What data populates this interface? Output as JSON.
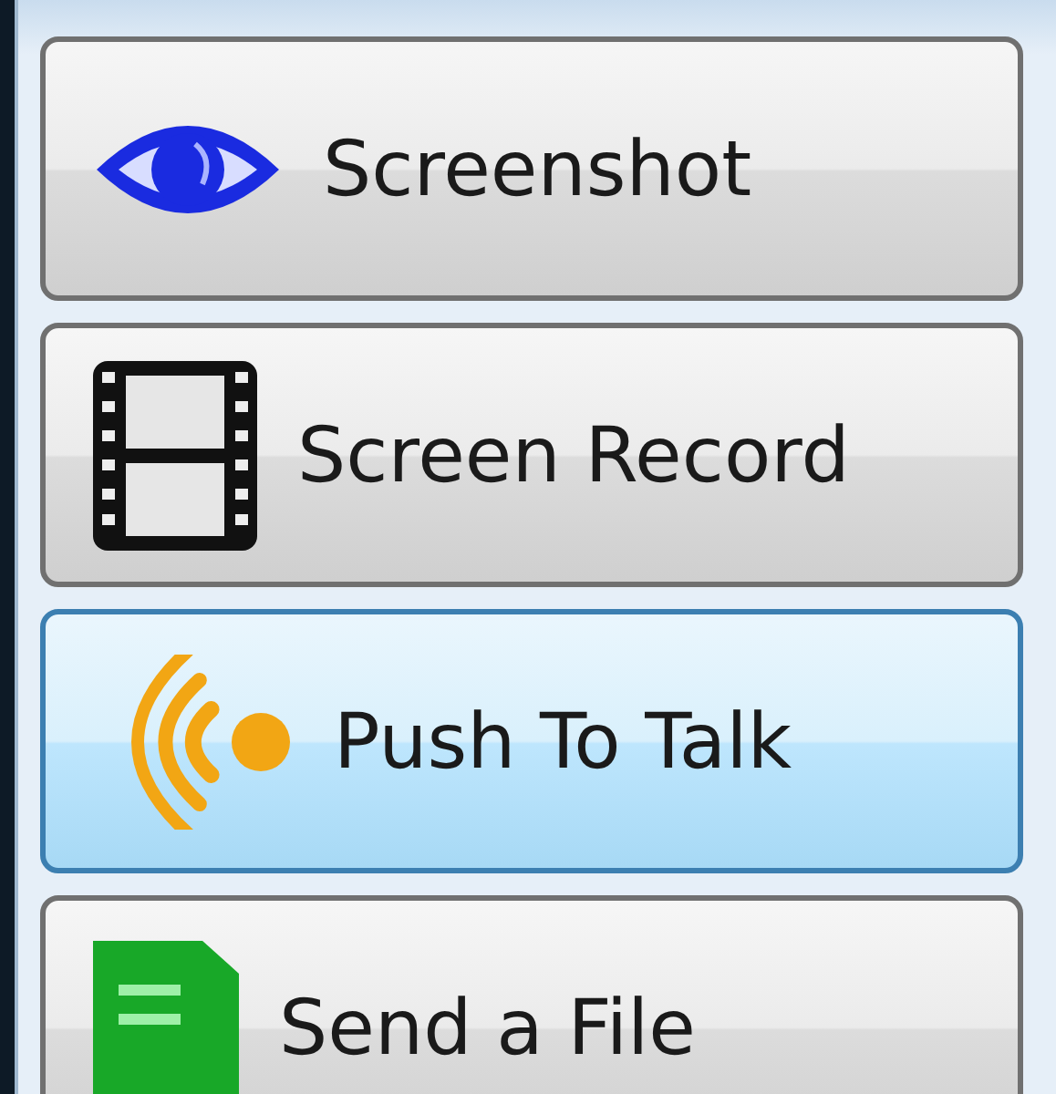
{
  "buttons": [
    {
      "label": "Screenshot",
      "kind": "eye",
      "highlighted": false
    },
    {
      "label": "Screen Record",
      "kind": "film",
      "highlighted": false
    },
    {
      "label": "Push To Talk",
      "kind": "signal",
      "highlighted": true
    },
    {
      "label": "Send a File",
      "kind": "file",
      "highlighted": false
    }
  ]
}
